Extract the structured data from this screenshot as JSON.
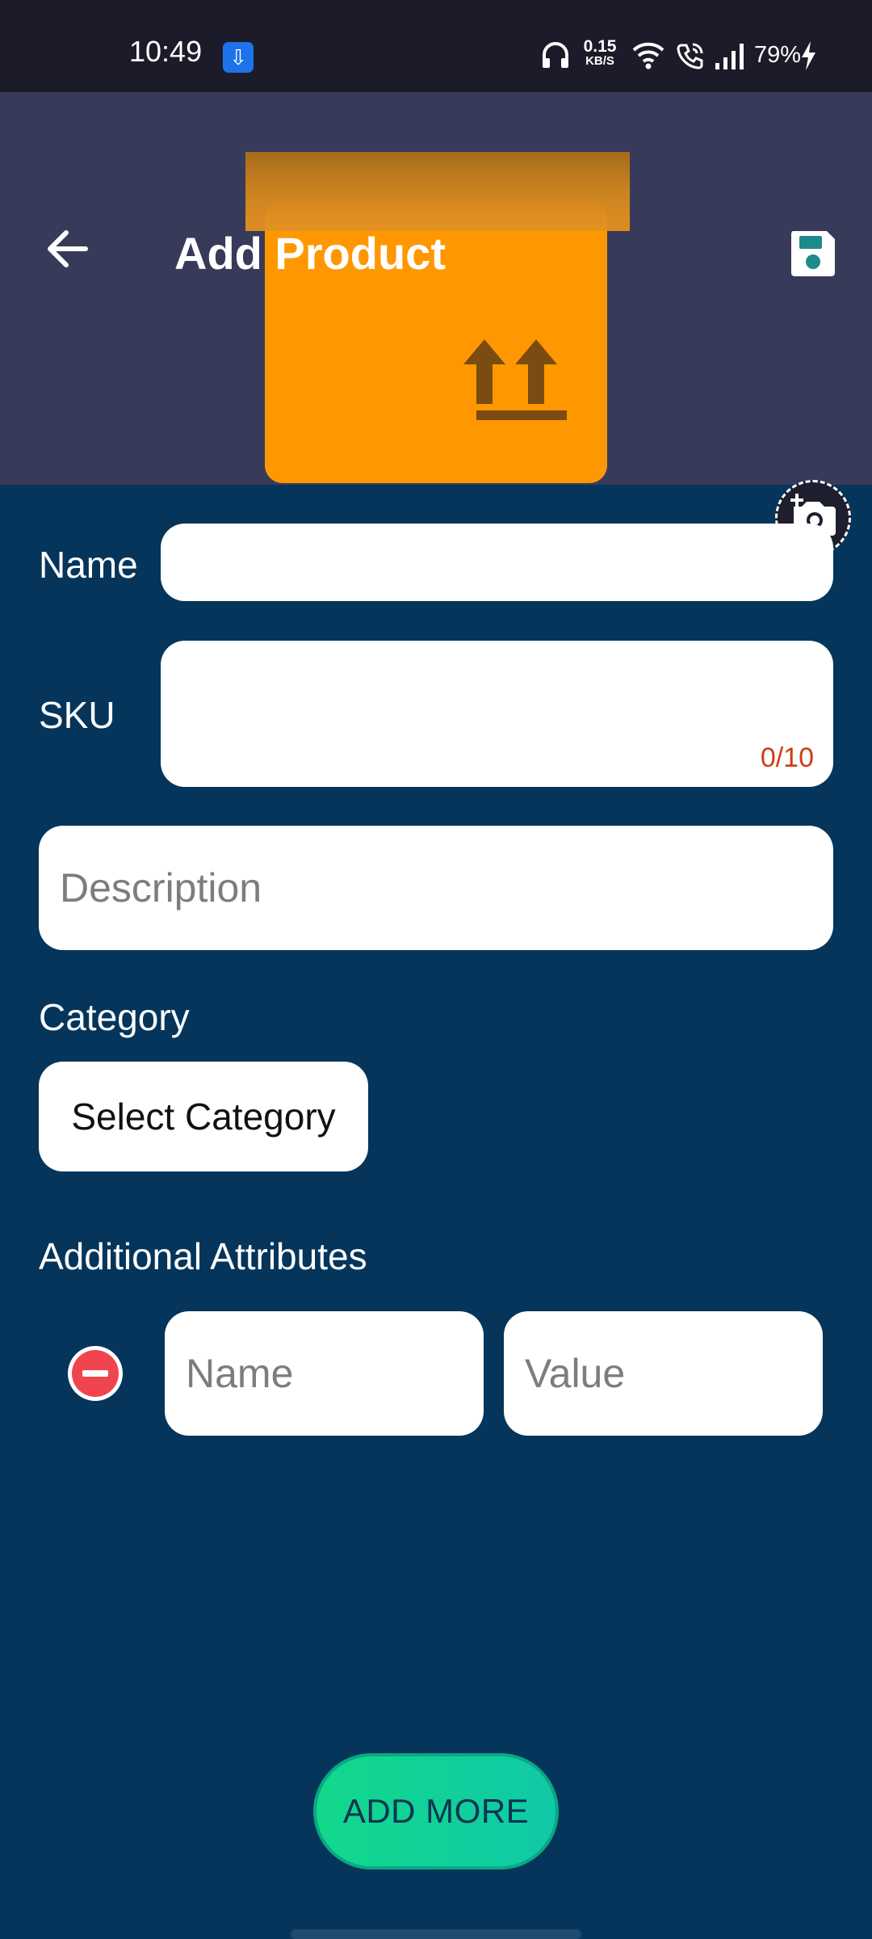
{
  "status_bar": {
    "time": "10:49",
    "usb_icon": "usb-icon",
    "speed_value": "0.15",
    "speed_unit": "KB/S",
    "battery": "79%"
  },
  "header": {
    "title": "Add Product",
    "back_icon": "arrow-back-icon",
    "save_icon": "floppy-disk-icon",
    "camera_icon": "add-photo-camera-icon",
    "image_icon": "package-box-icon"
  },
  "form": {
    "name_label": "Name",
    "name_value": "",
    "sku_label": "SKU",
    "sku_value": "",
    "sku_counter": "0/10",
    "description_placeholder": "Description",
    "category_label": "Category",
    "category_button": "Select Category",
    "attributes_label": "Additional Attributes",
    "attributes": [
      {
        "name_placeholder": "Name",
        "value_placeholder": "Value"
      }
    ],
    "add_more_button": "ADD MORE"
  },
  "colors": {
    "background": "#05355a",
    "header_background": "#383a5a",
    "status_bar": "#1b1b2a",
    "box_orange": "#ff9800",
    "counter_red": "#cc3d14",
    "add_more_green": "#12d88a",
    "remove_red": "#f0454f"
  }
}
